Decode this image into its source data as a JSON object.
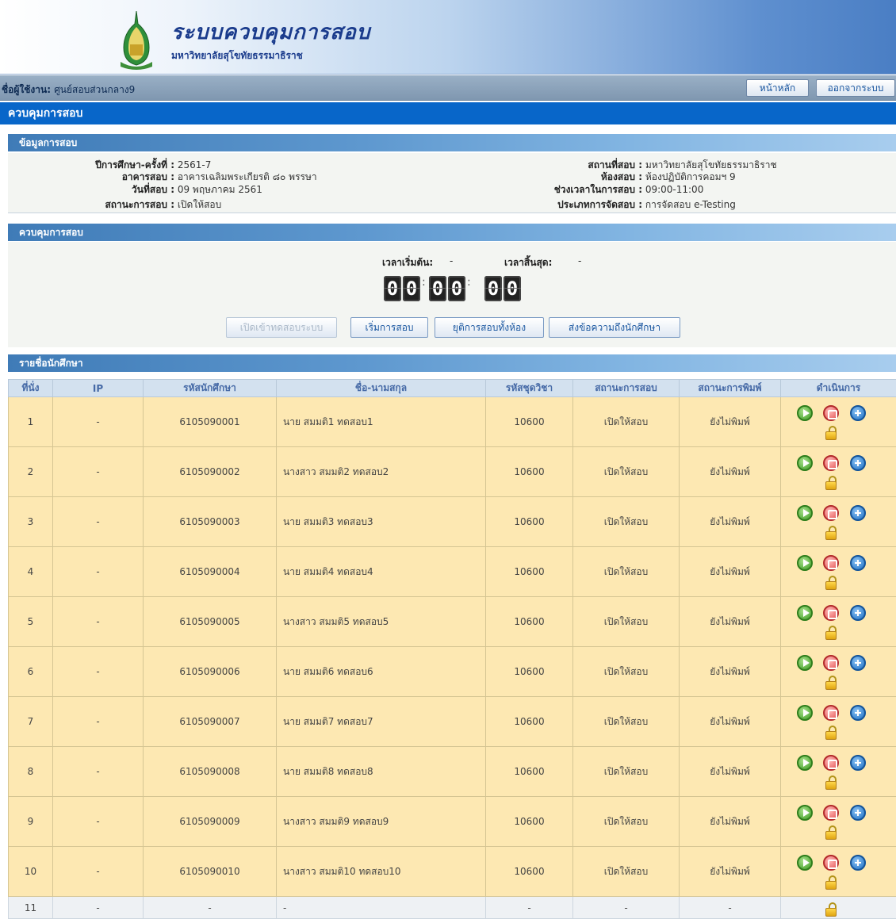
{
  "header": {
    "title": "ระบบควบคุมการสอบ",
    "subtitle": "มหาวิทยาลัยสุโขทัยธรรมาธิราช"
  },
  "userbar": {
    "label": "ชื่อผู้ใช้งาน:",
    "username": "ศูนย์สอบส่วนกลาง9",
    "home_button": "หน้าหลัก",
    "logout_button": "ออกจากระบบ"
  },
  "section_title": "ควบคุมการสอบ",
  "exam_info": {
    "heading": "ข้อมูลการสอบ",
    "left": [
      {
        "key": "ปีการศึกษา-ครั้งที่ :",
        "value": "2561-7"
      },
      {
        "key": "อาคารสอบ :",
        "value": "อาคารเฉลิมพระเกียรติ ๘๐ พรรษา"
      },
      {
        "key": "วันที่สอบ :",
        "value": "09 พฤษภาคม 2561"
      },
      {
        "key": "สถานะการสอบ :",
        "value": "เปิดให้สอบ"
      }
    ],
    "right": [
      {
        "key": "สถานที่สอบ :",
        "value": "มหาวิทยาลัยสุโขทัยธรรมาธิราช"
      },
      {
        "key": "ห้องสอบ :",
        "value": "ห้องปฏิบัติการคอมฯ 9"
      },
      {
        "key": "ช่วงเวลาในการสอบ :",
        "value": "09:00-11:00"
      },
      {
        "key": "ประเภทการจัดสอบ :",
        "value": "การจัดสอบ e-Testing"
      }
    ]
  },
  "control": {
    "heading": "ควบคุมการสอบ",
    "start_label": "เวลาเริ่มต้น:",
    "start_value": "-",
    "end_label": "เวลาสิ้นสุด:",
    "end_value": "-",
    "timer_digits": [
      "0",
      "0",
      "0",
      "0",
      "0",
      "0"
    ],
    "buttons": {
      "open_system": "เปิดเข้าทดสอบระบบ",
      "start_exam": "เริ่มการสอบ",
      "stop_all": "ยุติการสอบทั้งห้อง",
      "message": "ส่งข้อความถึงนักศึกษา"
    }
  },
  "students": {
    "heading": "รายชื่อนักศึกษา",
    "columns": [
      "ที่นั่ง",
      "IP",
      "รหัสนักศึกษา",
      "ชื่อ-นามสกุล",
      "รหัสชุดวิชา",
      "สถานะการสอบ",
      "สถานะการพิมพ์",
      "ดำเนินการ"
    ],
    "rows": [
      {
        "seat": "1",
        "ip": "-",
        "id": "6105090001",
        "name": "นาย สมมติ1 ทดสอบ1",
        "course": "10600",
        "exam_status": "เปิดให้สอบ",
        "print_status": "ยังไม่พิมพ์"
      },
      {
        "seat": "2",
        "ip": "-",
        "id": "6105090002",
        "name": "นางสาว สมมติ2 ทดสอบ2",
        "course": "10600",
        "exam_status": "เปิดให้สอบ",
        "print_status": "ยังไม่พิมพ์"
      },
      {
        "seat": "3",
        "ip": "-",
        "id": "6105090003",
        "name": "นาย สมมติ3 ทดสอบ3",
        "course": "10600",
        "exam_status": "เปิดให้สอบ",
        "print_status": "ยังไม่พิมพ์"
      },
      {
        "seat": "4",
        "ip": "-",
        "id": "6105090004",
        "name": "นาย สมมติ4 ทดสอบ4",
        "course": "10600",
        "exam_status": "เปิดให้สอบ",
        "print_status": "ยังไม่พิมพ์"
      },
      {
        "seat": "5",
        "ip": "-",
        "id": "6105090005",
        "name": "นางสาว สมมติ5 ทดสอบ5",
        "course": "10600",
        "exam_status": "เปิดให้สอบ",
        "print_status": "ยังไม่พิมพ์"
      },
      {
        "seat": "6",
        "ip": "-",
        "id": "6105090006",
        "name": "นาย สมมติ6 ทดสอบ6",
        "course": "10600",
        "exam_status": "เปิดให้สอบ",
        "print_status": "ยังไม่พิมพ์"
      },
      {
        "seat": "7",
        "ip": "-",
        "id": "6105090007",
        "name": "นาย สมมติ7 ทดสอบ7",
        "course": "10600",
        "exam_status": "เปิดให้สอบ",
        "print_status": "ยังไม่พิมพ์"
      },
      {
        "seat": "8",
        "ip": "-",
        "id": "6105090008",
        "name": "นาย สมมติ8 ทดสอบ8",
        "course": "10600",
        "exam_status": "เปิดให้สอบ",
        "print_status": "ยังไม่พิมพ์"
      },
      {
        "seat": "9",
        "ip": "-",
        "id": "6105090009",
        "name": "นางสาว สมมติ9 ทดสอบ9",
        "course": "10600",
        "exam_status": "เปิดให้สอบ",
        "print_status": "ยังไม่พิมพ์"
      },
      {
        "seat": "10",
        "ip": "-",
        "id": "6105090010",
        "name": "นางสาว สมมติ10 ทดสอบ10",
        "course": "10600",
        "exam_status": "เปิดให้สอบ",
        "print_status": "ยังไม่พิมพ์"
      }
    ],
    "last_row": {
      "seat": "11",
      "ip": "-",
      "id": "-",
      "name": "-",
      "course": "-",
      "exam_status": "-",
      "print_status": "-"
    }
  }
}
